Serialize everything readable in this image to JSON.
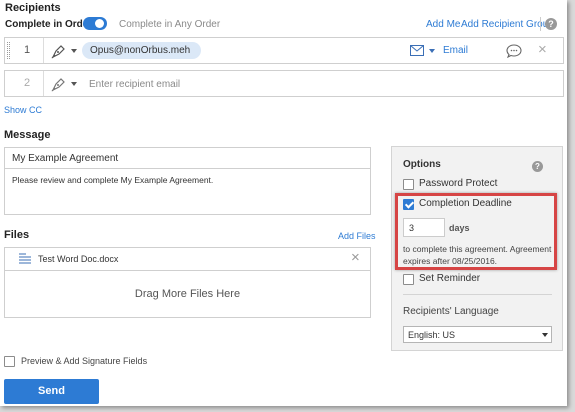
{
  "recipients": {
    "title": "Recipients",
    "complete_in_order": "Complete in Order",
    "complete_in_any_order": "Complete in Any Order",
    "add_me": "Add Me",
    "add_recipient_group": "Add Recipient Group",
    "help": "?",
    "rows": [
      {
        "number": "1",
        "email": "Opus@nonOrbus.meh",
        "method": "Email"
      },
      {
        "number": "2",
        "placeholder": "Enter recipient email"
      }
    ],
    "show_cc": "Show CC"
  },
  "message": {
    "title": "Message",
    "agreement_name": "My Example Agreement",
    "body": "Please review and complete My Example Agreement."
  },
  "files": {
    "title": "Files",
    "add_files": "Add Files",
    "file_name": "Test Word Doc.docx",
    "drop_zone": "Drag More Files Here"
  },
  "options": {
    "title": "Options",
    "help": "?",
    "password_protect": "Password Protect",
    "completion_deadline": "Completion Deadline",
    "completion_deadline_checked": true,
    "days_value": "3",
    "days_label": "days",
    "deadline_note": "to complete this agreement. Agreement expires after 08/25/2016.",
    "set_reminder": "Set Reminder",
    "recipients_language": "Recipients' Language",
    "language_value": "English: US"
  },
  "footer": {
    "preview_label": "Preview & Add Signature Fields",
    "send": "Send"
  },
  "colors": {
    "accent": "#2d7bd4",
    "highlight": "#d64545"
  }
}
